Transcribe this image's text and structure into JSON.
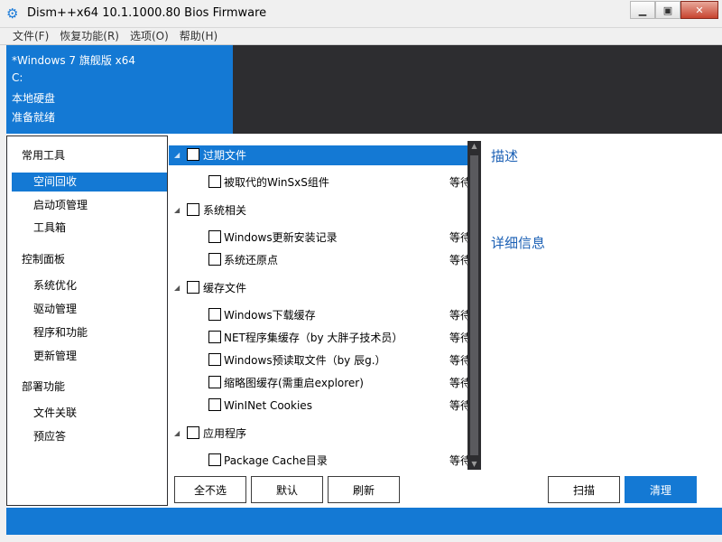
{
  "window": {
    "title": "Dism++x64 10.1.1000.80 Bios Firmware"
  },
  "menu": [
    "文件(F)",
    "恢复功能(R)",
    "选项(O)",
    "帮助(H)"
  ],
  "info": {
    "line1": "*Windows 7 旗舰版 x64",
    "line2": "C:",
    "line3": "本地硬盘",
    "line4": "准备就绪"
  },
  "sidebar": {
    "categories": [
      {
        "label": "常用工具",
        "items": [
          "空间回收",
          "启动项管理",
          "工具箱"
        ]
      },
      {
        "label": "控制面板",
        "items": [
          "系统优化",
          "驱动管理",
          "程序和功能",
          "更新管理"
        ]
      },
      {
        "label": "部署功能",
        "items": [
          "文件关联",
          "预应答"
        ]
      }
    ],
    "selected": "空间回收"
  },
  "list": {
    "groups": [
      {
        "label": "过期文件",
        "selected": true,
        "items": [
          {
            "label": "被取代的WinSxS组件",
            "status": "等待"
          }
        ]
      },
      {
        "label": "系统相关",
        "items": [
          {
            "label": "Windows更新安装记录",
            "status": "等待"
          },
          {
            "label": "系统还原点",
            "status": "等待"
          }
        ]
      },
      {
        "label": "缓存文件",
        "items": [
          {
            "label": "Windows下载缓存",
            "status": "等待"
          },
          {
            "label": "NET程序集缓存（by 大胖子技术员）",
            "status": "等待"
          },
          {
            "label": "Windows预读取文件（by 辰g.）",
            "status": "等待"
          },
          {
            "label": "缩略图缓存(需重启explorer)",
            "status": "等待"
          },
          {
            "label": "WinINet Cookies",
            "status": "等待"
          }
        ]
      },
      {
        "label": "应用程序",
        "items": [
          {
            "label": "Package Cache目录",
            "status": "等待"
          }
        ]
      }
    ]
  },
  "details": {
    "desc_title": "描述",
    "detail_title": "详细信息"
  },
  "buttons": {
    "deselect_all": "全不选",
    "default": "默认",
    "refresh": "刷新",
    "scan": "扫描",
    "clean": "清理"
  },
  "colors": {
    "accent": "#1479d4",
    "dark": "#2d2d30",
    "heading": "#1a5fb4"
  }
}
